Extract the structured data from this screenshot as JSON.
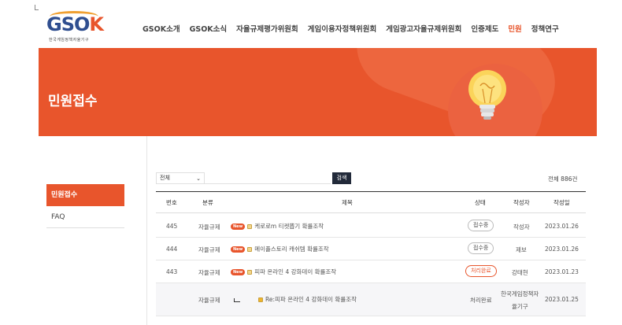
{
  "logo": {
    "main_g": "GSO",
    "main_k": "K",
    "sub": "한국게임정책자율기구"
  },
  "nav": {
    "items": [
      "GSOK소개",
      "GSOK소식",
      "자율규제평가위원회",
      "게임이용자정책위원회",
      "게임광고자율규제위원회",
      "인증제도",
      "민원",
      "정책연구"
    ],
    "active_index": 6
  },
  "banner": {
    "title": "민원접수"
  },
  "sidebar": {
    "items": [
      "민원접수",
      "FAQ"
    ],
    "active_index": 0
  },
  "search": {
    "select_value": "전체",
    "input_value": "",
    "button_label": "검색"
  },
  "total": "전체 886건",
  "table": {
    "headers": [
      "번호",
      "분류",
      "제목",
      "상태",
      "작성자",
      "작성일"
    ],
    "rows": [
      {
        "num": "445",
        "category": "자율규제",
        "badge": "New",
        "title": "케로로m 티켓뽑기 확률조작",
        "status": "접수중",
        "author": "작성자",
        "date": "2023.01.26"
      },
      {
        "num": "444",
        "category": "자율규제",
        "badge": "New",
        "title": "메이플스토리 캐쉬템 확률조작",
        "status": "접수중",
        "author": "제보",
        "date": "2023.01.26"
      },
      {
        "num": "443",
        "category": "자율규제",
        "badge": "New",
        "title": "피파 온라인 4 강화데이 확률조작",
        "status": "처리완료",
        "author": "강태현",
        "date": "2023.01.23"
      },
      {
        "num": "",
        "category": "자율규제",
        "badge": "",
        "title": "Re:피파 온라인 4 강화데이 확률조작",
        "status": "처리완료",
        "author_line1": "한국게임정책자",
        "author_line2": "율기구",
        "date": "2023.01.25"
      }
    ]
  },
  "colors": {
    "accent": "#e8552c",
    "dark_button": "#222a3a"
  }
}
